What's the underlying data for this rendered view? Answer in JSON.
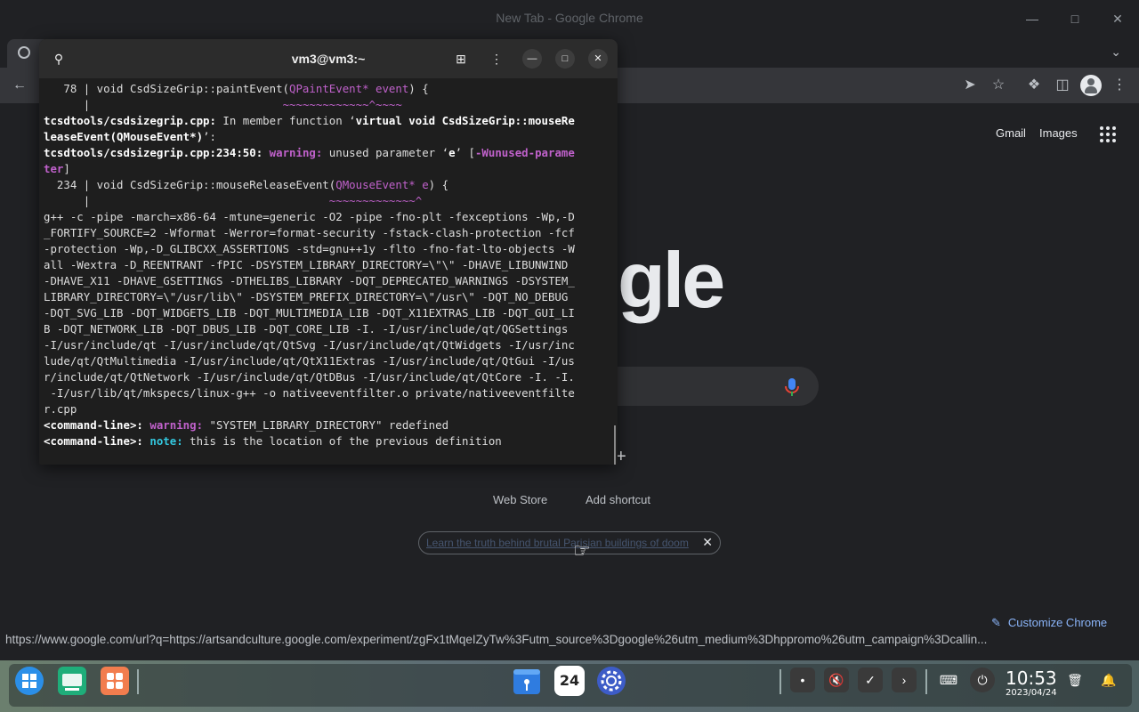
{
  "chrome": {
    "window_title": "New Tab - Google Chrome",
    "links": {
      "gmail": "Gmail",
      "images": "Images"
    },
    "logo_fragment": "gle",
    "shortcuts": {
      "web_store": "Web Store",
      "add_shortcut": "Add shortcut"
    },
    "promo_text": "Learn the truth behind brutal Parisian buildings of doom",
    "customize_label": "Customize Chrome",
    "status_url": "https://www.google.com/url?q=https://artsandculture.google.com/experiment/zgFx1tMqeIZyTw%3Futm_source%3Dgoogle%26utm_medium%3Dhppromo%26utm_campaign%3Dcallin..."
  },
  "terminal": {
    "title": "vm3@vm3:~",
    "lines": {
      "l1_a": "   78 | void CsdSizeGrip::paintEvent(",
      "l1_b": "QPaintEvent* event",
      "l1_c": ") {",
      "l2_a": "      |                             ",
      "l2_b": "~~~~~~~~~~~~~^~~~~",
      "l3_a": "tcsdtools/csdsizegrip.cpp:",
      "l3_b": " In member function ‘",
      "l3_c": "virtual void CsdSizeGrip::mouseRe",
      "l4_a": "leaseEvent(QMouseEvent*)",
      "l4_b": "’:",
      "l5_a": "tcsdtools/csdsizegrip.cpp:234:50:",
      "l5_b": " warning:",
      "l5_c": " unused parameter ‘",
      "l5_d": "e",
      "l5_e": "’ [",
      "l5_f": "-Wunused-parame",
      "l6_a": "ter",
      "l6_b": "]",
      "l7_a": "  234 | void CsdSizeGrip::mouseReleaseEvent(",
      "l7_b": "QMouseEvent* e",
      "l7_c": ") {",
      "l8_a": "      |                                    ",
      "l8_b": "~~~~~~~~~~~~~^",
      "compile": [
        "g++ -c -pipe -march=x86-64 -mtune=generic -O2 -pipe -fno-plt -fexceptions -Wp,-D",
        "_FORTIFY_SOURCE=2 -Wformat -Werror=format-security -fstack-clash-protection -fcf",
        "-protection -Wp,-D_GLIBCXX_ASSERTIONS -std=gnu++1y -flto -fno-fat-lto-objects -W",
        "all -Wextra -D_REENTRANT -fPIC -DSYSTEM_LIBRARY_DIRECTORY=\\\"\\\" -DHAVE_LIBUNWIND",
        "-DHAVE_X11 -DHAVE_GSETTINGS -DTHELIBS_LIBRARY -DQT_DEPRECATED_WARNINGS -DSYSTEM_",
        "LIBRARY_DIRECTORY=\\\"/usr/lib\\\" -DSYSTEM_PREFIX_DIRECTORY=\\\"/usr\\\" -DQT_NO_DEBUG",
        "-DQT_SVG_LIB -DQT_WIDGETS_LIB -DQT_MULTIMEDIA_LIB -DQT_X11EXTRAS_LIB -DQT_GUI_LI",
        "B -DQT_NETWORK_LIB -DQT_DBUS_LIB -DQT_CORE_LIB -I. -I/usr/include/qt/QGSettings",
        "-I/usr/include/qt -I/usr/include/qt/QtSvg -I/usr/include/qt/QtWidgets -I/usr/inc",
        "lude/qt/QtMultimedia -I/usr/include/qt/QtX11Extras -I/usr/include/qt/QtGui -I/us",
        "r/include/qt/QtNetwork -I/usr/include/qt/QtDBus -I/usr/include/qt/QtCore -I. -I.",
        " -I/usr/lib/qt/mkspecs/linux-g++ -o nativeeventfilter.o private/nativeeventfilte",
        "r.cpp"
      ],
      "w1_a": "<command-line>:",
      "w1_b": " warning:",
      "w1_c": " \"SYSTEM_LIBRARY_DIRECTORY\" redefined",
      "w2_a": "<command-line>:",
      "w2_b": " note:",
      "w2_c": " this is the location of the previous definition"
    }
  },
  "taskbar": {
    "clock_time": "10:53",
    "clock_date": "2023/04/24",
    "calendar_day": "24"
  }
}
